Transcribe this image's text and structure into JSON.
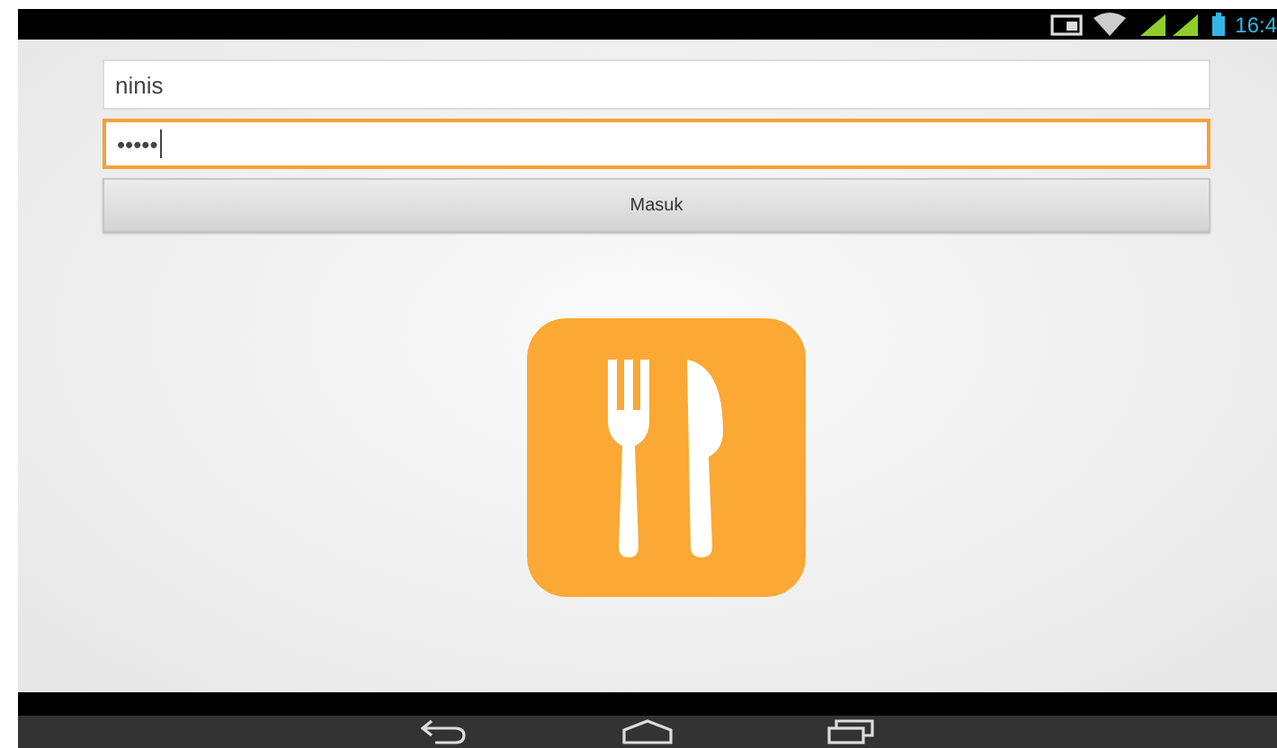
{
  "status_bar": {
    "time": "16:4"
  },
  "username": {
    "value": "ninis",
    "focused": false
  },
  "password": {
    "value": "•••••",
    "focused": true
  },
  "login_button": {
    "label": "Masuk"
  }
}
